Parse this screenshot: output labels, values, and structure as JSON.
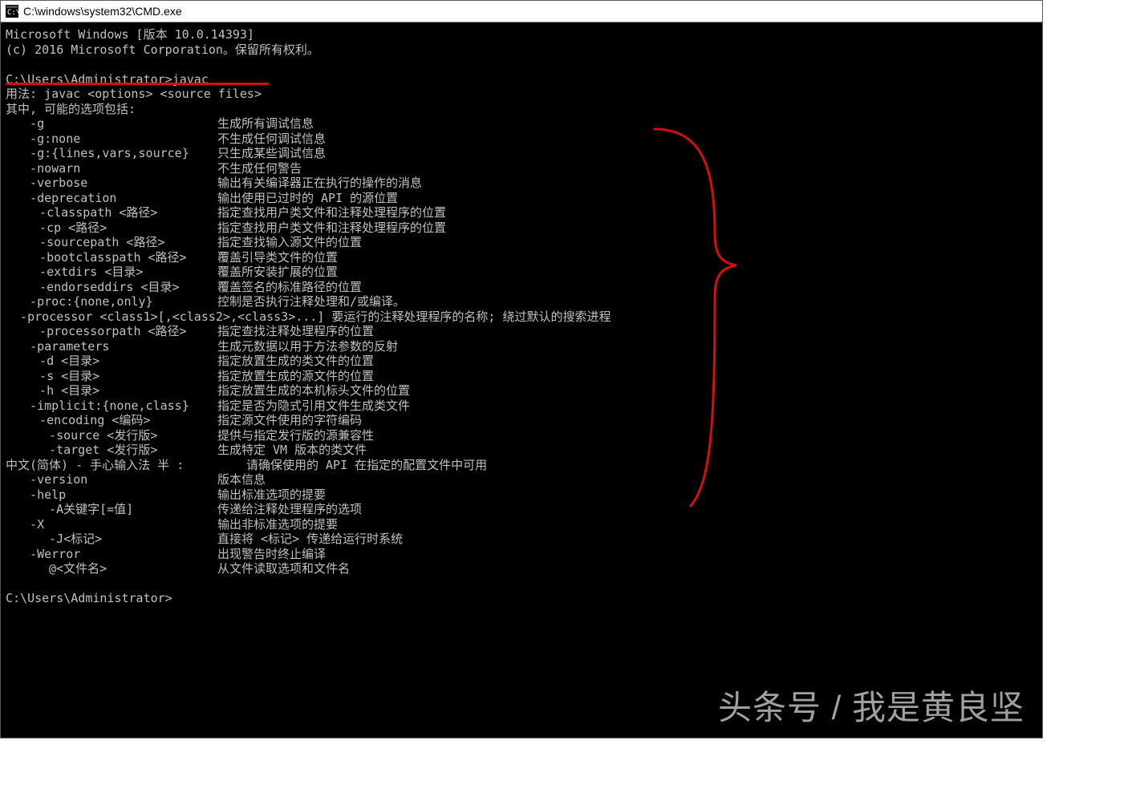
{
  "window": {
    "title": "C:\\windows\\system32\\CMD.exe"
  },
  "terminal": {
    "banner1": "Microsoft Windows [版本 10.0.14393]",
    "banner2": "(c) 2016 Microsoft Corporation。保留所有权利。",
    "prompt1_path": "C:\\Users\\Administrator>",
    "prompt1_cmd": "javac",
    "usage": "用法: javac <options> <source files>",
    "where": "其中, 可能的选项包括:",
    "options": [
      {
        "flag": "-g",
        "desc": "生成所有调试信息",
        "pad": "pad1"
      },
      {
        "flag": "-g:none",
        "desc": "不生成任何调试信息",
        "pad": "pad1"
      },
      {
        "flag": "-g:{lines,vars,source}",
        "desc": "只生成某些调试信息",
        "pad": "pad1"
      },
      {
        "flag": "-nowarn",
        "desc": "不生成任何警告",
        "pad": "pad1"
      },
      {
        "flag": "-verbose",
        "desc": "输出有关编译器正在执行的操作的消息",
        "pad": "pad1"
      },
      {
        "flag": "-deprecation",
        "desc": "输出使用已过时的 API 的源位置",
        "pad": "pad1"
      },
      {
        "flag": "-classpath <路径>",
        "desc": "指定查找用户类文件和注释处理程序的位置",
        "pad": "pad2"
      },
      {
        "flag": "-cp <路径>",
        "desc": "指定查找用户类文件和注释处理程序的位置",
        "pad": "pad2"
      },
      {
        "flag": "-sourcepath <路径>",
        "desc": "指定查找输入源文件的位置",
        "pad": "pad2"
      },
      {
        "flag": "-bootclasspath <路径>",
        "desc": "覆盖引导类文件的位置",
        "pad": "pad2"
      },
      {
        "flag": "-extdirs <目录>",
        "desc": "覆盖所安装扩展的位置",
        "pad": "pad2"
      },
      {
        "flag": "-endorseddirs <目录>",
        "desc": "覆盖签名的标准路径的位置",
        "pad": "pad2"
      },
      {
        "flag": "-proc:{none,only}",
        "desc": "控制是否执行注释处理和/或编译。",
        "pad": "pad1"
      },
      {
        "flag": "-processor <class1>[,<class2>,<class3>...]",
        "desc": "要运行的注释处理程序的名称; 绕过默认的搜索进程",
        "pad": ""
      },
      {
        "flag": "-processorpath <路径>",
        "desc": "指定查找注释处理程序的位置",
        "pad": "pad2"
      },
      {
        "flag": "-parameters",
        "desc": "生成元数据以用于方法参数的反射",
        "pad": "pad1"
      },
      {
        "flag": "-d <目录>",
        "desc": "指定放置生成的类文件的位置",
        "pad": "pad2"
      },
      {
        "flag": "-s <目录>",
        "desc": "指定放置生成的源文件的位置",
        "pad": "pad2"
      },
      {
        "flag": "-h <目录>",
        "desc": "指定放置生成的本机标头文件的位置",
        "pad": "pad2"
      },
      {
        "flag": "-implicit:{none,class}",
        "desc": "指定是否为隐式引用文件生成类文件",
        "pad": "pad1"
      },
      {
        "flag": "-encoding <编码>",
        "desc": "指定源文件使用的字符编码",
        "pad": "pad2"
      },
      {
        "flag": "-source <发行版>",
        "desc": "提供与指定发行版的源兼容性",
        "pad": "pad3"
      },
      {
        "flag": "-target <发行版>",
        "desc": "生成特定 VM 版本的类文件",
        "pad": "pad3"
      },
      {
        "flag": "",
        "desc": "请确保使用的 API 在指定的配置文件中可用",
        "pad": "pad3",
        "ime": true
      },
      {
        "flag": "-version",
        "desc": "版本信息",
        "pad": "pad1"
      },
      {
        "flag": "-help",
        "desc": "输出标准选项的提要",
        "pad": "pad1"
      },
      {
        "flag": "-A关键字[=值]",
        "desc": "传递给注释处理程序的选项",
        "pad": "pad3"
      },
      {
        "flag": "-X",
        "desc": "输出非标准选项的提要",
        "pad": "pad1"
      },
      {
        "flag": "-J<标记>",
        "desc": "直接将 <标记> 传递给运行时系统",
        "pad": "pad3"
      },
      {
        "flag": "-Werror",
        "desc": "出现警告时终止编译",
        "pad": "pad1"
      },
      {
        "flag": "@<文件名>",
        "desc": "从文件读取选项和文件名",
        "pad": "pad3"
      }
    ],
    "ime_text": "中文(简体) - 手心输入法 半 :",
    "prompt2": "C:\\Users\\Administrator>"
  },
  "watermark": "头条号 / 我是黄良坚",
  "annotations": {
    "underline_color": "#d60e0e",
    "brace_color": "#d60e0e"
  }
}
